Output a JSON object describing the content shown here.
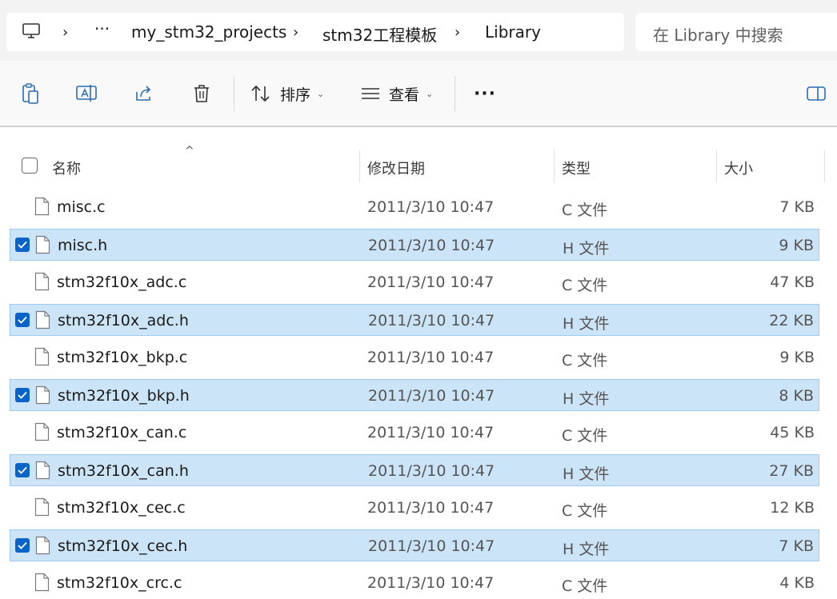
{
  "breadcrumb": {
    "items": [
      "my_stm32_projects",
      "stm32工程模板",
      "Library"
    ],
    "overflow": "···",
    "separator": "›"
  },
  "search": {
    "placeholder": "在 Library 中搜索"
  },
  "toolbar": {
    "sort_label": "排序",
    "view_label": "查看",
    "more_label": "···"
  },
  "columns": {
    "name": "名称",
    "date": "修改日期",
    "type": "类型",
    "size": "大小"
  },
  "colors": {
    "selected_bg": "#cce4f7",
    "checkbox": "#0a64c8",
    "accent": "#0a64c8"
  },
  "files": [
    {
      "name": "misc.c",
      "date": "2011/3/10 10:47",
      "type": "C 文件",
      "size": "7 KB",
      "selected": false
    },
    {
      "name": "misc.h",
      "date": "2011/3/10 10:47",
      "type": "H 文件",
      "size": "9 KB",
      "selected": true
    },
    {
      "name": "stm32f10x_adc.c",
      "date": "2011/3/10 10:47",
      "type": "C 文件",
      "size": "47 KB",
      "selected": false
    },
    {
      "name": "stm32f10x_adc.h",
      "date": "2011/3/10 10:47",
      "type": "H 文件",
      "size": "22 KB",
      "selected": true
    },
    {
      "name": "stm32f10x_bkp.c",
      "date": "2011/3/10 10:47",
      "type": "C 文件",
      "size": "9 KB",
      "selected": false
    },
    {
      "name": "stm32f10x_bkp.h",
      "date": "2011/3/10 10:47",
      "type": "H 文件",
      "size": "8 KB",
      "selected": true
    },
    {
      "name": "stm32f10x_can.c",
      "date": "2011/3/10 10:47",
      "type": "C 文件",
      "size": "45 KB",
      "selected": false
    },
    {
      "name": "stm32f10x_can.h",
      "date": "2011/3/10 10:47",
      "type": "H 文件",
      "size": "27 KB",
      "selected": true
    },
    {
      "name": "stm32f10x_cec.c",
      "date": "2011/3/10 10:47",
      "type": "C 文件",
      "size": "12 KB",
      "selected": false
    },
    {
      "name": "stm32f10x_cec.h",
      "date": "2011/3/10 10:47",
      "type": "H 文件",
      "size": "7 KB",
      "selected": true
    },
    {
      "name": "stm32f10x_crc.c",
      "date": "2011/3/10 10:47",
      "type": "C 文件",
      "size": "4 KB",
      "selected": false
    }
  ]
}
